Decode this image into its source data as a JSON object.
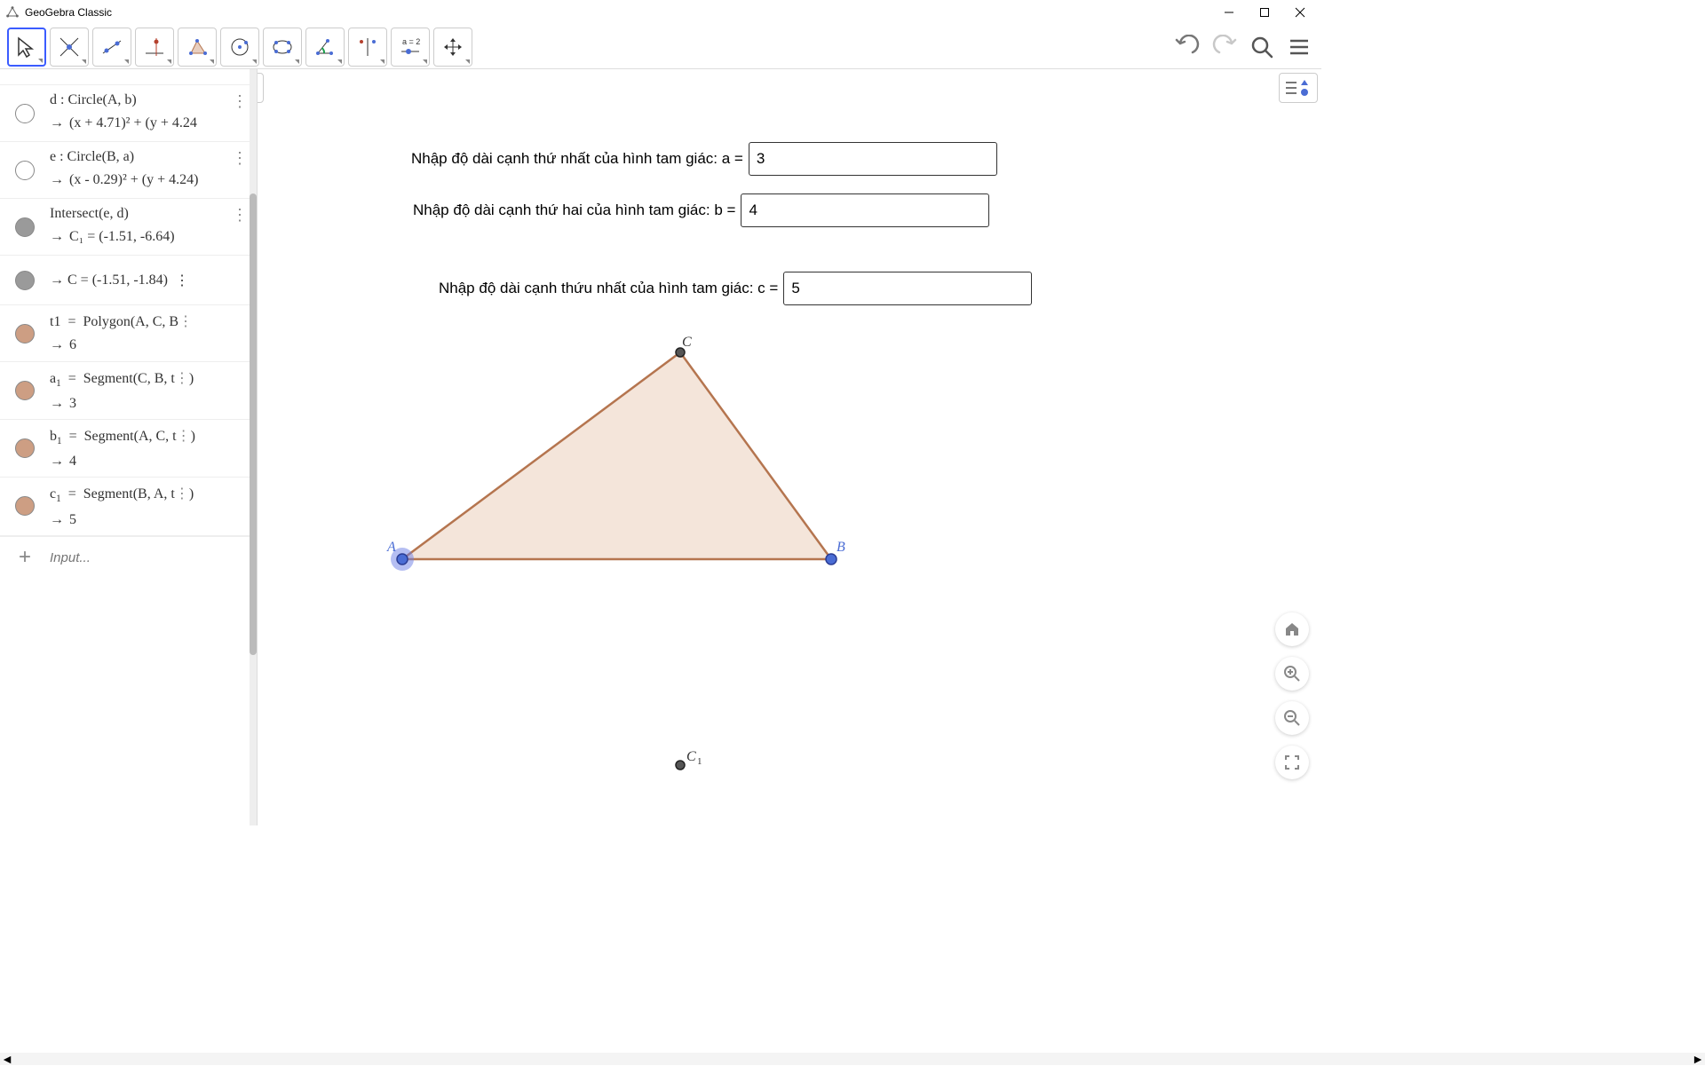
{
  "window": {
    "title": "GeoGebra Classic"
  },
  "algebra": {
    "items": [
      {
        "def": "d : Circle(A, b)",
        "val": "(x + 4.71)² + (y + 4.24",
        "dot": "#ffffff"
      },
      {
        "def": "e : Circle(B, a)",
        "val": "(x - 0.29)² + (y + 4.24)",
        "dot": "#ffffff"
      },
      {
        "def": "Intersect(e, d)",
        "val": "C₁ = (-1.51, -6.64)",
        "dot": "#9a9a9a"
      },
      {
        "def": "",
        "val": "C = (-1.51, -1.84)",
        "dot": "#9a9a9a",
        "single": true
      },
      {
        "def": "t1 = Polygon(A, C, B)",
        "val": "6",
        "dot": "#cd9e83"
      },
      {
        "def": "a₁ = Segment(C, B, t1)",
        "val": "3",
        "dot": "#cd9e83"
      },
      {
        "def": "b₁ = Segment(A, C, t1)",
        "val": "4",
        "dot": "#cd9e83"
      },
      {
        "def": "c₁ = Segment(B, A, t1)",
        "val": "5",
        "dot": "#cd9e83"
      }
    ],
    "input_placeholder": "Input..."
  },
  "inputs": {
    "a": {
      "label": "Nhập độ dài cạnh thứ nhất của hình tam giác: a =",
      "value": "3"
    },
    "b": {
      "label": "Nhập độ dài cạnh thứ hai của hình tam giác: b =",
      "value": "4"
    },
    "c": {
      "label": "Nhập độ dài cạnh thứu nhất của hình tam giác: c =",
      "value": "5"
    }
  },
  "points": {
    "A": {
      "label": "A"
    },
    "B": {
      "label": "B"
    },
    "C": {
      "label": "C"
    },
    "C1": {
      "label": "C₁"
    }
  }
}
